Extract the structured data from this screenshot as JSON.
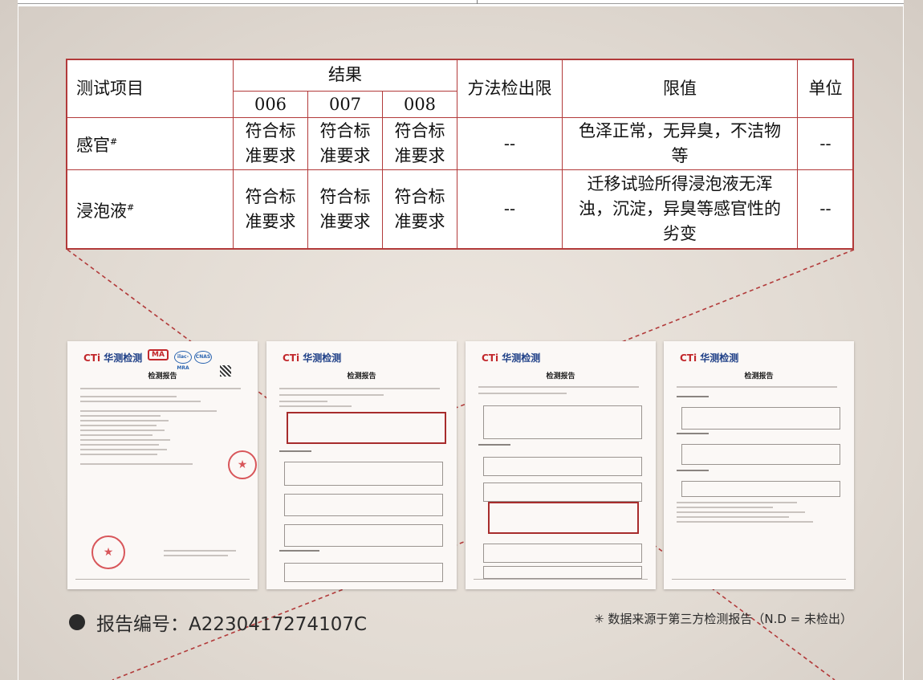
{
  "table": {
    "headers": {
      "item": "测试项目",
      "result": "结果",
      "samples": [
        "006",
        "007",
        "008"
      ],
      "method_limit": "方法检出限",
      "limit": "限值",
      "unit": "单位"
    },
    "rows": [
      {
        "item": "感官",
        "mark": "#",
        "results": [
          [
            "符合标",
            "准要求"
          ],
          [
            "符合标",
            "准要求"
          ],
          [
            "符合标",
            "准要求"
          ]
        ],
        "method_limit": "--",
        "limit": [
          "色泽正常，无异臭，不洁物",
          "等"
        ],
        "unit": "--"
      },
      {
        "item": "浸泡液",
        "mark": "#",
        "results": [
          [
            "符合标",
            "准要求"
          ],
          [
            "符合标",
            "准要求"
          ],
          [
            "符合标",
            "准要求"
          ]
        ],
        "method_limit": "--",
        "limit": [
          "迁移试验所得浸泡液无浑",
          "浊，沉淀，异臭等感官性的",
          "劣变"
        ],
        "unit": "--"
      }
    ]
  },
  "documents": {
    "logo_prefix": "CTi",
    "logo_text": "华测检测",
    "title": "检测报告",
    "badges": [
      "MA",
      "ilac-MRA",
      "CNAS"
    ],
    "stamp_symbol": "★"
  },
  "footer": {
    "report_number": "报告编号：A2230417274107C",
    "source_note": "✳ 数据来源于第三方检测报告（N.D = 未检出）"
  },
  "colors": {
    "accent_red": "#b23a3a",
    "logo_blue": "#1e3f87"
  }
}
